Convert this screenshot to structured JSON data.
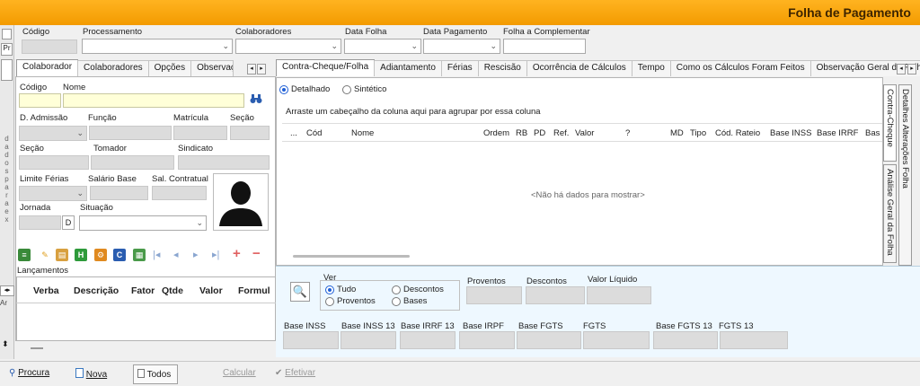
{
  "window": {
    "title": "Folha de Pagamento"
  },
  "filters": {
    "codigo_label": "Código",
    "processamento_label": "Processamento",
    "colaboradores_label": "Colaboradores",
    "data_folha_label": "Data Folha",
    "data_pagamento_label": "Data Pagamento",
    "folha_complementar_label": "Folha a Complementar"
  },
  "left_tabs": [
    "Colaborador",
    "Colaboradores",
    "Opções",
    "Observaç"
  ],
  "colaborador": {
    "codigo_label": "Código",
    "nome_label": "Nome",
    "admissao_label": "D. Admissão",
    "funcao_label": "Função",
    "matricula_label": "Matrícula",
    "secao_label": "Seção",
    "secao2_label": "Seção",
    "tomador_label": "Tomador",
    "sindicato_label": "Sindicato",
    "limite_ferias_label": "Limite Férias",
    "salario_base_label": "Salário Base",
    "sal_contratual_label": "Sal. Contratual",
    "jornada_label": "Jornada",
    "jornada_unit": "D",
    "situacao_label": "Situação"
  },
  "left_strip_letters": [
    "d",
    "a",
    "d",
    "o",
    "s",
    "p",
    "a",
    "r",
    "a",
    "e",
    "x"
  ],
  "lancamentos": {
    "title": "Lançamentos",
    "columns": [
      "Verba",
      "Descrição",
      "Fator",
      "Qtde",
      "Valor",
      "Formul"
    ],
    "side_label": "Ar"
  },
  "right_tabs": [
    "Contra-Cheque/Folha",
    "Adiantamento",
    "Férias",
    "Rescisão",
    "Ocorrência de Cálculos",
    "Tempo",
    "Como os Cálculos Foram Feitos",
    "Observação Geral da Folha"
  ],
  "view_mode": {
    "detalhado": "Detalhado",
    "sintetico": "Sintético",
    "selected": "Detalhado"
  },
  "grid": {
    "group_hint": "Arraste um cabeçalho da coluna aqui para agrupar por essa coluna",
    "columns": [
      "...",
      "Cód",
      "Nome",
      "Ordem",
      "RB",
      "PD",
      "Ref.",
      "Valor",
      "?",
      "MD",
      "Tipo",
      "Cód. Rateio",
      "Base INSS",
      "Base IRRF",
      "Bas"
    ],
    "empty_text": "<Não há dados para mostrar>"
  },
  "vertical_tabs": {
    "contra_cheque": "Contra-Cheque",
    "analise": "Análise Geral da Folha",
    "detalhes": "Detalhes Alterações Folha"
  },
  "ver": {
    "title": "Ver",
    "tudo": "Tudo",
    "descontos": "Descontos",
    "proventos": "Proventos",
    "bases": "Bases",
    "selected": "Tudo"
  },
  "totals": {
    "proventos": "Proventos",
    "descontos": "Descontos",
    "valor_liquido": "Valor Líquido"
  },
  "bases": [
    "Base INSS",
    "Base INSS 13",
    "Base IRRF 13",
    "Base IRPF",
    "Base FGTS",
    "FGTS",
    "Base FGTS 13",
    "FGTS 13"
  ],
  "buttons": {
    "procura": "Procura",
    "nova": "Nova",
    "todos": "Todos",
    "calcular": "Calcular",
    "efetivar": "Efetivar"
  }
}
